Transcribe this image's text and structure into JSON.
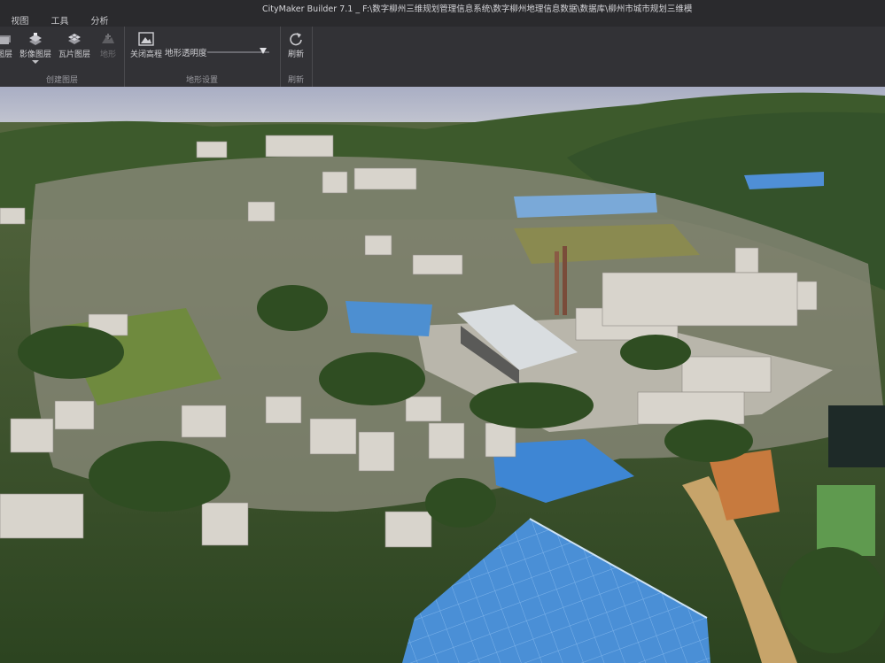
{
  "window": {
    "title": "CityMaker Builder 7.1 _ F:\\数字柳州三维规划管理信息系统\\数字柳州地理信息数据\\数据库\\柳州市城市规划三维模"
  },
  "menu": {
    "items": [
      "视图",
      "工具",
      "分析"
    ]
  },
  "ribbon": {
    "create_layer_group": {
      "label": "创建图层",
      "buttons": {
        "layer_partial": "图层",
        "image_layer": "影像图层",
        "tile_layer": "瓦片图层",
        "terrain": "地形"
      }
    },
    "terrain_settings_group": {
      "label": "地形设置",
      "close_elevation": "关闭高程",
      "terrain_transparency": "地形透明度",
      "transparency_value": 0.9
    },
    "refresh_group": {
      "label": "刷新",
      "refresh_button": "刷新"
    }
  },
  "colors": {
    "titlebar": "#2a2a2d",
    "ribbon": "#323236",
    "sky": "#b8bccb",
    "vegetation": "#3f5f2c",
    "roof_blue": "#4d8fd1"
  }
}
